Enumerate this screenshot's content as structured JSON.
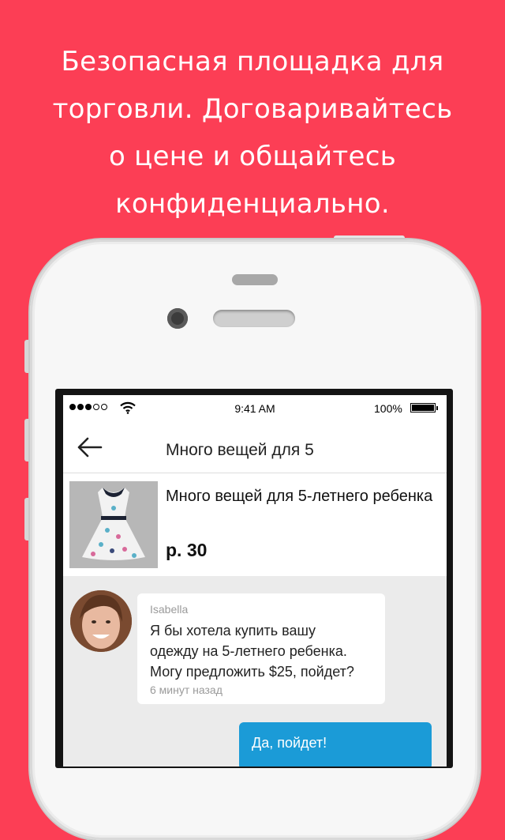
{
  "headline": {
    "lines": [
      "Безопасная площадка для",
      "торговли. Договаривайтесь",
      "о цене и общайтесь",
      "конфиденциально."
    ]
  },
  "status_bar": {
    "time": "9:41 AM",
    "battery": "100%"
  },
  "nav": {
    "title": "Много вещей для 5",
    "back_icon": "arrow-left-icon"
  },
  "product": {
    "title": "Много вещей для 5-летнего ребенка",
    "price": "р. 30"
  },
  "chat": {
    "incoming": {
      "sender": "Isabella",
      "text_lines": [
        "Я бы хотела купить вашу",
        "одежду на 5-летнего ребенка.",
        "Могу предложить $25, пойдет?"
      ],
      "time": "6 минут назад"
    },
    "outgoing": {
      "text": "Да, пойдет!"
    }
  },
  "colors": {
    "background": "#fc3e55",
    "reply_bubble": "#1b9bd7"
  }
}
